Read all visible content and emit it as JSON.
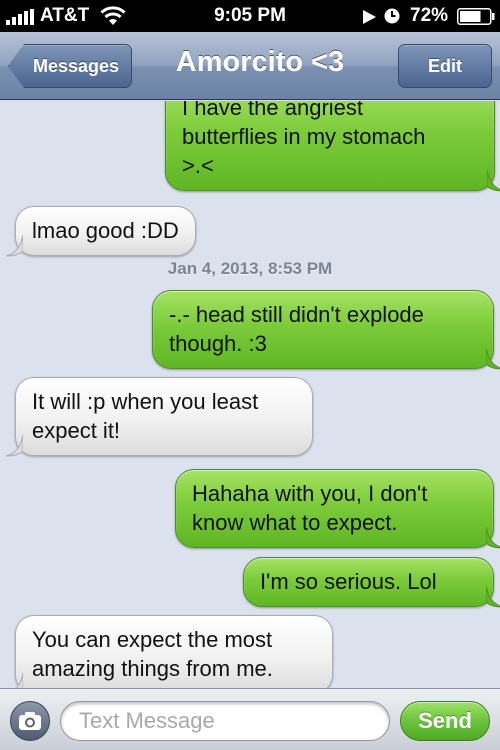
{
  "status_bar": {
    "carrier": "AT&T",
    "time": "9:05 PM",
    "battery_percent": "72%",
    "battery_level": 0.72,
    "icons": [
      "signal-icon",
      "wifi-icon",
      "play-icon",
      "clock-icon",
      "battery-icon"
    ]
  },
  "nav": {
    "back_label": "Messages",
    "title": "Amorcito <3",
    "edit_label": "Edit"
  },
  "conversation": {
    "timestamp": "Jan 4, 2013, 8:53 PM",
    "messages": [
      {
        "direction": "sent",
        "lines": [
          "I have the angriest",
          "butterflies in my stomach",
          ">.<"
        ]
      },
      {
        "direction": "received",
        "lines": [
          "lmao good :DD"
        ]
      },
      {
        "direction": "sent",
        "lines": [
          "-.- head still didn't explode",
          "though. :3"
        ]
      },
      {
        "direction": "received",
        "lines": [
          "It will :p when you least",
          "expect it!"
        ]
      },
      {
        "direction": "sent",
        "lines": [
          "Hahaha with you, I don't",
          "know what to expect."
        ]
      },
      {
        "direction": "sent",
        "lines": [
          "I'm so serious. Lol"
        ]
      },
      {
        "direction": "received",
        "lines": [
          "You can expect the most",
          "amazing things from me."
        ]
      }
    ]
  },
  "input": {
    "placeholder": "Text Message",
    "value": "",
    "send_label": "Send"
  },
  "colors": {
    "sent_bubble": "#7ccb3a",
    "received_bubble": "#f1f1f1",
    "background": "#dbe2ed",
    "nav_bar": "#8fa2bf"
  }
}
